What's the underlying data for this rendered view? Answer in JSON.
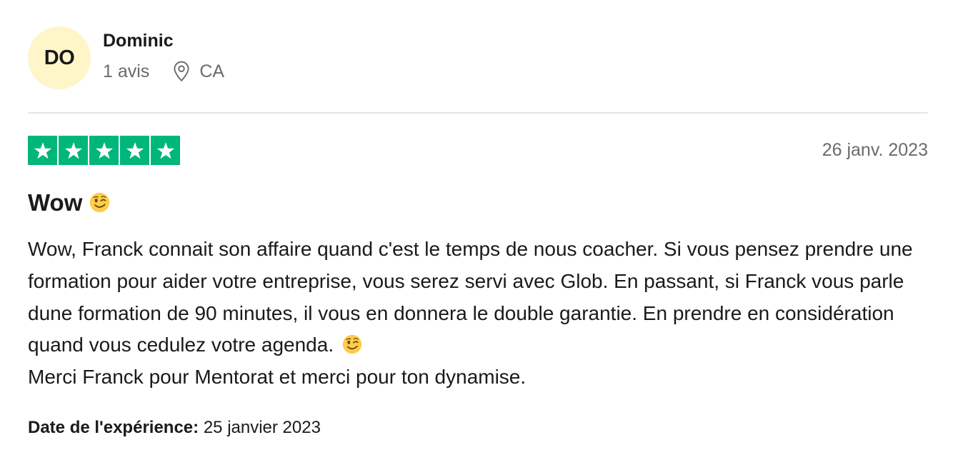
{
  "reviewer": {
    "initials": "DO",
    "name": "Dominic",
    "review_count": "1 avis",
    "location": "CA",
    "avatar_color": "#fef6c8"
  },
  "rating": {
    "stars": 5,
    "max_stars": 5,
    "color": "#00b67a",
    "icon": "star-icon"
  },
  "review": {
    "date": "26 janv. 2023",
    "title": "Wow",
    "title_emoji": "winking-face-emoji",
    "body_part1": "Wow, Franck connait son affaire quand c'est le temps de nous coacher. Si vous pensez prendre une formation pour aider votre entreprise, vous serez servi avec Glob. En passant, si Franck vous parle dune formation de 90 minutes, il vous en donnera le double garantie. En prendre en considération quand vous cedulez votre agenda.",
    "body_emoji": "winking-face-emoji",
    "body_part2": "Merci Franck pour Mentorat et merci pour ton dynamise."
  },
  "experience": {
    "label": "Date de l'expérience:",
    "value": "25 janvier 2023"
  }
}
